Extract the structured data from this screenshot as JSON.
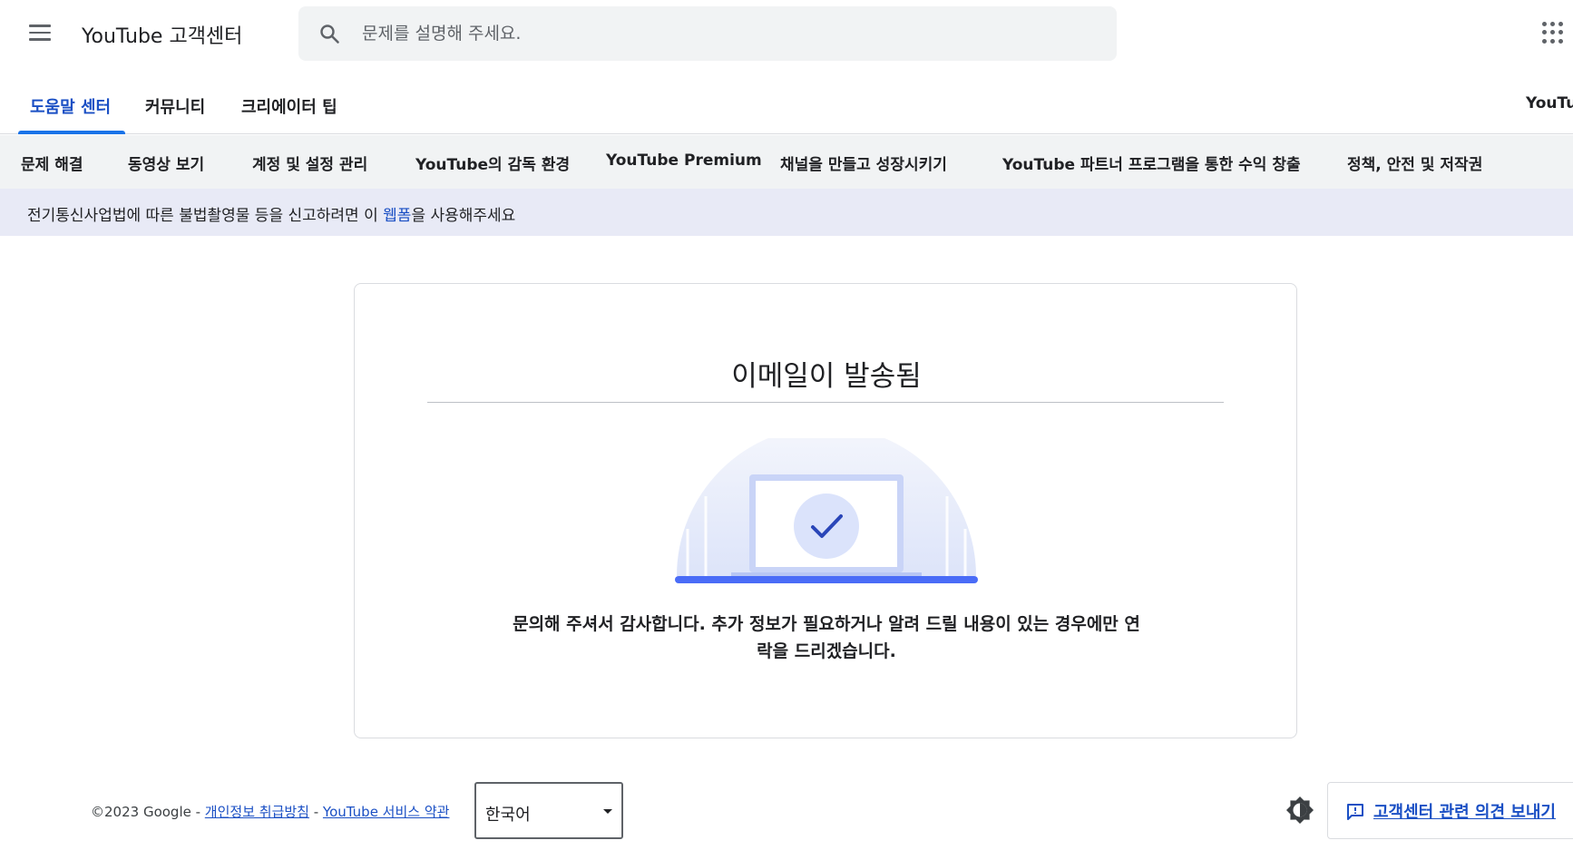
{
  "header": {
    "title": "YouTube 고객센터",
    "search_placeholder": "문제를 설명해 주세요."
  },
  "tabs": {
    "items": [
      {
        "label": "도움말 센터",
        "active": true
      },
      {
        "label": "커뮤니티",
        "active": false
      },
      {
        "label": "크리에이터 팁",
        "active": false
      }
    ],
    "right_label": "YouTul"
  },
  "categories": [
    "문제 해결",
    "동영상 보기",
    "계정 및 설정 관리",
    "YouTube의 감독 환경",
    "YouTube Premium",
    "채널을 만들고 성장시키기",
    "YouTube 파트너 프로그램을 통한 수익 창출",
    "정책, 안전 및 저작권"
  ],
  "banner": {
    "text_before": "전기통신사업법에 따른 불법촬영물   등을 신고하려면 이 ",
    "link_text": "웹폼",
    "text_after": "을 사용해주세요"
  },
  "card": {
    "title": "이메일이 발송됨",
    "message": "문의해 주셔서 감사합니다. 추가 정보가 필요하거나 알려 드릴 내용이 있는 경우에만 연락을 드리겠습니다."
  },
  "footer": {
    "copyright": "©2023 Google - ",
    "privacy_link": "개인정보 취급방침",
    "separator": " - ",
    "terms_link": "YouTube 서비스 약관",
    "language_selected": "한국어",
    "feedback_label": "고객센터 관련 의견 보내기"
  },
  "colors": {
    "accent": "#1a73e8",
    "link": "#1a4fc4",
    "banner_bg": "#e8eaf6",
    "nav_bg": "#f1f3f4",
    "illustration_blue": "#4a6cf7"
  },
  "icons": {
    "menu": "menu-icon",
    "search": "search-icon",
    "apps": "apps-grid-icon",
    "check": "check-icon",
    "theme": "brightness-icon",
    "feedback": "feedback-icon"
  }
}
